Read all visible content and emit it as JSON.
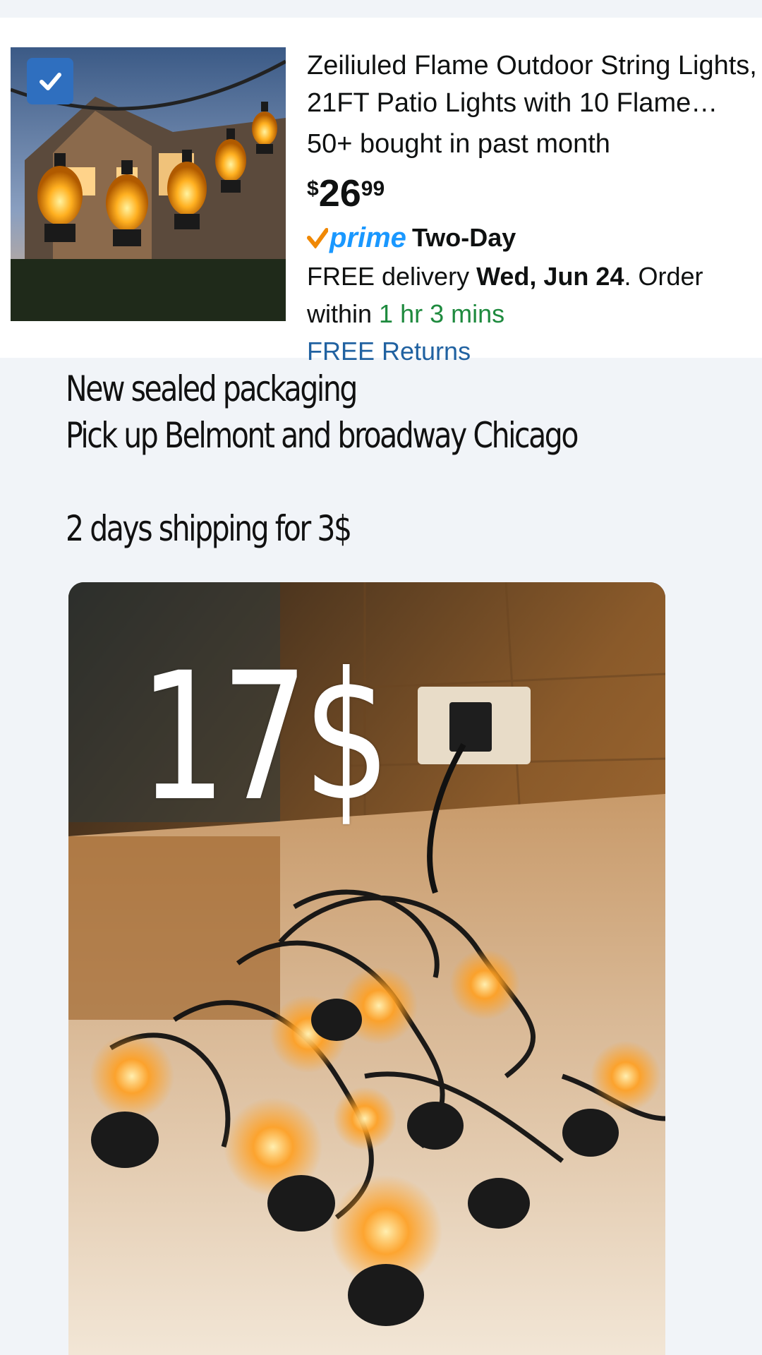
{
  "product": {
    "title": "Zeiliuled Flame Outdoor String Lights, 21FT Patio Lights with 10 Flame Lanterns",
    "bought": "50+ bought in past month",
    "price": {
      "symbol": "$",
      "whole": "26",
      "fraction": "99"
    },
    "prime": {
      "badge": "prime",
      "speed": "Two-Day"
    },
    "delivery": {
      "prefix": "FREE delivery ",
      "date": "Wed, Jun 24",
      "middle": ". Order within ",
      "countdown": "1 hr 3 mins"
    },
    "returns": "FREE Returns",
    "selected": true
  },
  "note": {
    "line1": "New sealed packaging",
    "line2": "Pick up Belmont and broadway Chicago",
    "line3": "2 days shipping for 3$"
  },
  "photo": {
    "overlay_price": "17$"
  },
  "colors": {
    "prime_blue": "#1a98ff",
    "prime_check": "#f08804",
    "countdown_green": "#1e8a3e",
    "link_blue": "#2162a1",
    "checkbox_blue": "#2f6fbf"
  }
}
